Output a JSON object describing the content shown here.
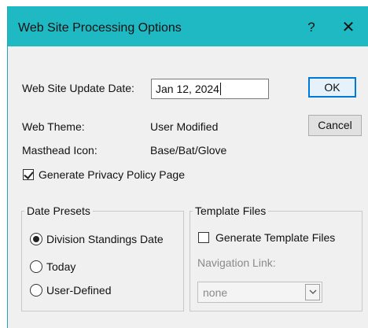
{
  "window": {
    "title": "Web Site Processing Options",
    "help_glyph": "?",
    "close_glyph": "✕"
  },
  "update_date": {
    "label": "Web Site Update Date:",
    "value": "Jan 12, 2024"
  },
  "buttons": {
    "ok": "OK",
    "cancel": "Cancel"
  },
  "web_theme": {
    "label": "Web Theme:",
    "value": "User Modified"
  },
  "masthead_icon": {
    "label": "Masthead Icon:",
    "value": "Base/Bat/Glove"
  },
  "privacy": {
    "label": "Generate Privacy Policy Page",
    "checked": true
  },
  "date_presets": {
    "legend": "Date Presets",
    "options": [
      "Division Standings Date",
      "Today",
      "User-Defined"
    ],
    "selected": "Division Standings Date"
  },
  "template_files": {
    "legend": "Template Files",
    "generate_label": "Generate Template Files",
    "generate_checked": false,
    "nav_link_label": "Navigation Link:",
    "nav_link_value": "none"
  },
  "colors": {
    "titlebar": "#1fb9c3",
    "dialog_bg": "#f0f0f0",
    "default_button_border": "#0078d7"
  },
  "icons": {
    "help": "help-icon",
    "close": "close-icon",
    "check": "checkmark-icon",
    "dropdown": "chevron-down-icon"
  }
}
